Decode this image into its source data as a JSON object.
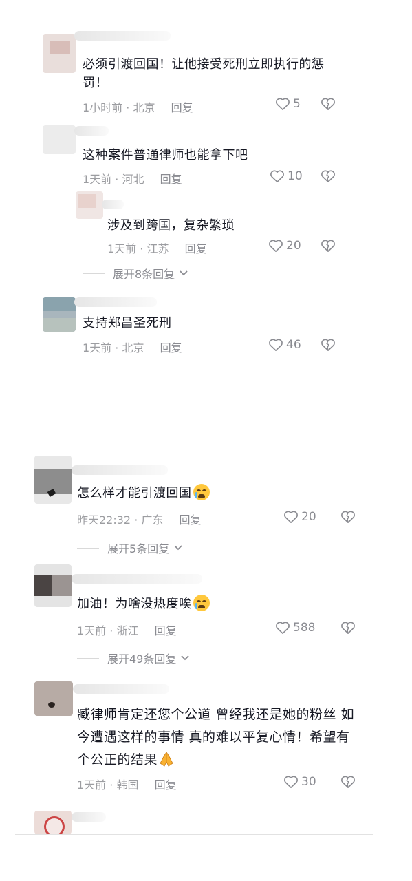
{
  "comments": [
    {
      "text": "必须引渡回国！让他接受死刑立即执行的惩罚！",
      "time": "1小时前",
      "location": "北京",
      "reply": "回复",
      "likes": "5"
    },
    {
      "text": "这种案件普通律师也能拿下吧",
      "time": "1天前",
      "location": "河北",
      "reply": "回复",
      "likes": "10"
    },
    {
      "text": "涉及到跨国，复杂繁琐",
      "time": "1天前",
      "location": "江苏",
      "reply": "回复",
      "likes": "20"
    },
    {
      "text": "支持郑昌圣死刑",
      "time": "1天前",
      "location": "北京",
      "reply": "回复",
      "likes": "46"
    },
    {
      "text": "怎么样才能引渡回国",
      "time": "昨天22:32",
      "location": "广东",
      "reply": "回复",
      "likes": "20",
      "emoji": "loudly-crying-emoji"
    },
    {
      "text": "加油！为啥没热度唉",
      "time": "1天前",
      "location": "浙江",
      "reply": "回复",
      "likes": "588",
      "emoji": "loudly-crying-emoji"
    },
    {
      "text": "臧律师肯定还您个公道 曾经我还是她的粉丝 如今遭遇这样的事情 真的难以平复心情！希望有个公正的结果",
      "time": "1天前",
      "location": "韩国",
      "reply": "回复",
      "likes": "30",
      "emoji": "folded-hands-emoji"
    }
  ],
  "expand": [
    "展开8条回复",
    "展开5条回复",
    "展开49条回复"
  ],
  "separator": "·",
  "icons": {
    "like": "heart-outline-icon",
    "dislike": "broken-heart-icon",
    "expand": "chevron-down-icon"
  },
  "colors": {
    "text": "#161823",
    "meta": "#9c9da1",
    "icon": "#8a8b91"
  }
}
